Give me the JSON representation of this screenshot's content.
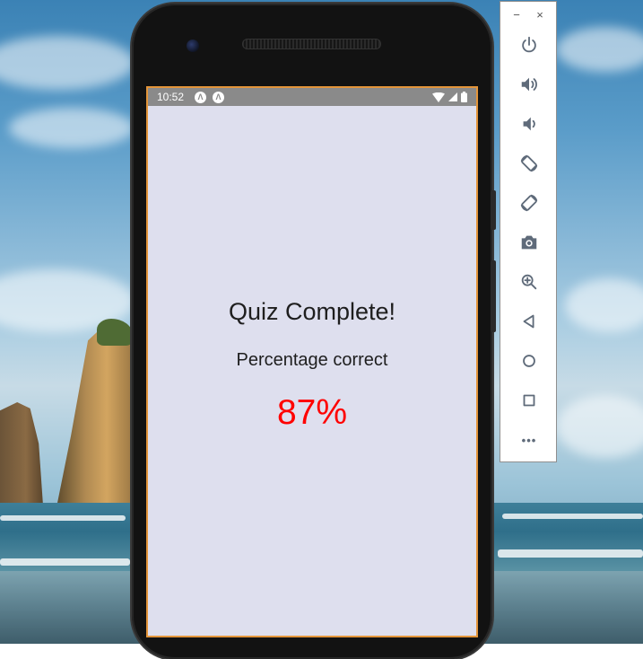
{
  "statusbar": {
    "time": "10:52",
    "notification_icons": [
      "app-notification-icon",
      "app-notification-icon"
    ],
    "right_icons": [
      "wifi-icon",
      "signal-icon",
      "battery-icon"
    ]
  },
  "app": {
    "title": "Quiz Complete!",
    "subtitle": "Percentage correct",
    "percentage": "87%",
    "percentage_color": "#ff0000",
    "background_color": "#dedfee"
  },
  "emulator_panel": {
    "window_controls": [
      "−",
      "×"
    ],
    "buttons": [
      {
        "name": "power",
        "icon": "power-icon"
      },
      {
        "name": "volume-up",
        "icon": "volume-up-icon"
      },
      {
        "name": "volume-down",
        "icon": "volume-down-icon"
      },
      {
        "name": "rotate-left",
        "icon": "rotate-left-icon"
      },
      {
        "name": "rotate-right",
        "icon": "rotate-right-icon"
      },
      {
        "name": "screenshot",
        "icon": "camera-icon"
      },
      {
        "name": "zoom",
        "icon": "zoom-icon"
      },
      {
        "name": "back",
        "icon": "back-triangle-icon"
      },
      {
        "name": "home",
        "icon": "home-circle-icon"
      },
      {
        "name": "overview",
        "icon": "overview-square-icon"
      },
      {
        "name": "more",
        "icon": "more-dots-icon",
        "label": "•••"
      }
    ]
  }
}
